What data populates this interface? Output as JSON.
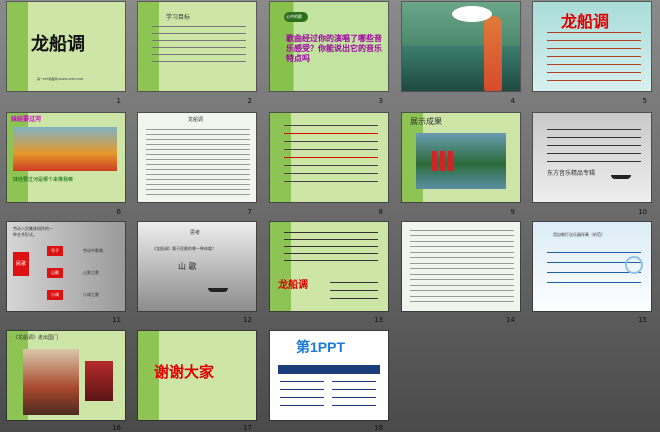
{
  "slides": [
    {
      "num": "1",
      "title": "龙船调",
      "footer": "第一PPT模板网-WWW.1PPT.COM"
    },
    {
      "num": "2",
      "heading": "学习目标"
    },
    {
      "num": "3",
      "badge": "心中的歌",
      "text": "歌曲经过你的演唱了哪些音乐感受？你能说出它的音乐特点吗"
    },
    {
      "num": "4"
    },
    {
      "num": "5",
      "title": "龙船调"
    },
    {
      "num": "6",
      "caption": "妹娃要过河是哪个来推我嘛"
    },
    {
      "num": "7",
      "heading": "龙船调"
    },
    {
      "num": "8"
    },
    {
      "num": "9",
      "heading": "展示成果"
    },
    {
      "num": "10",
      "caption": "东方音乐精品专辑"
    },
    {
      "num": "11",
      "intro": "劳动人民集体创作的一种艺术形式。",
      "chart": [
        "民歌",
        "号子",
        "山歌",
        "小调"
      ],
      "right": [
        "劳动中歌唱",
        "山野之歌",
        "小调之歌"
      ]
    },
    {
      "num": "12",
      "head": "思考",
      "q": "《龙船调》属于民歌的哪一种体裁？",
      "answer": "山 歌"
    },
    {
      "num": "13",
      "title": "龙船调"
    },
    {
      "num": "14"
    },
    {
      "num": "15",
      "heading": "用自制打击乐器伴奏（听范)"
    },
    {
      "num": "16",
      "heading": "《龙船调》走出国门"
    },
    {
      "num": "17",
      "text": "谢谢大家"
    },
    {
      "num": "18",
      "logo": "第1PPT"
    }
  ]
}
